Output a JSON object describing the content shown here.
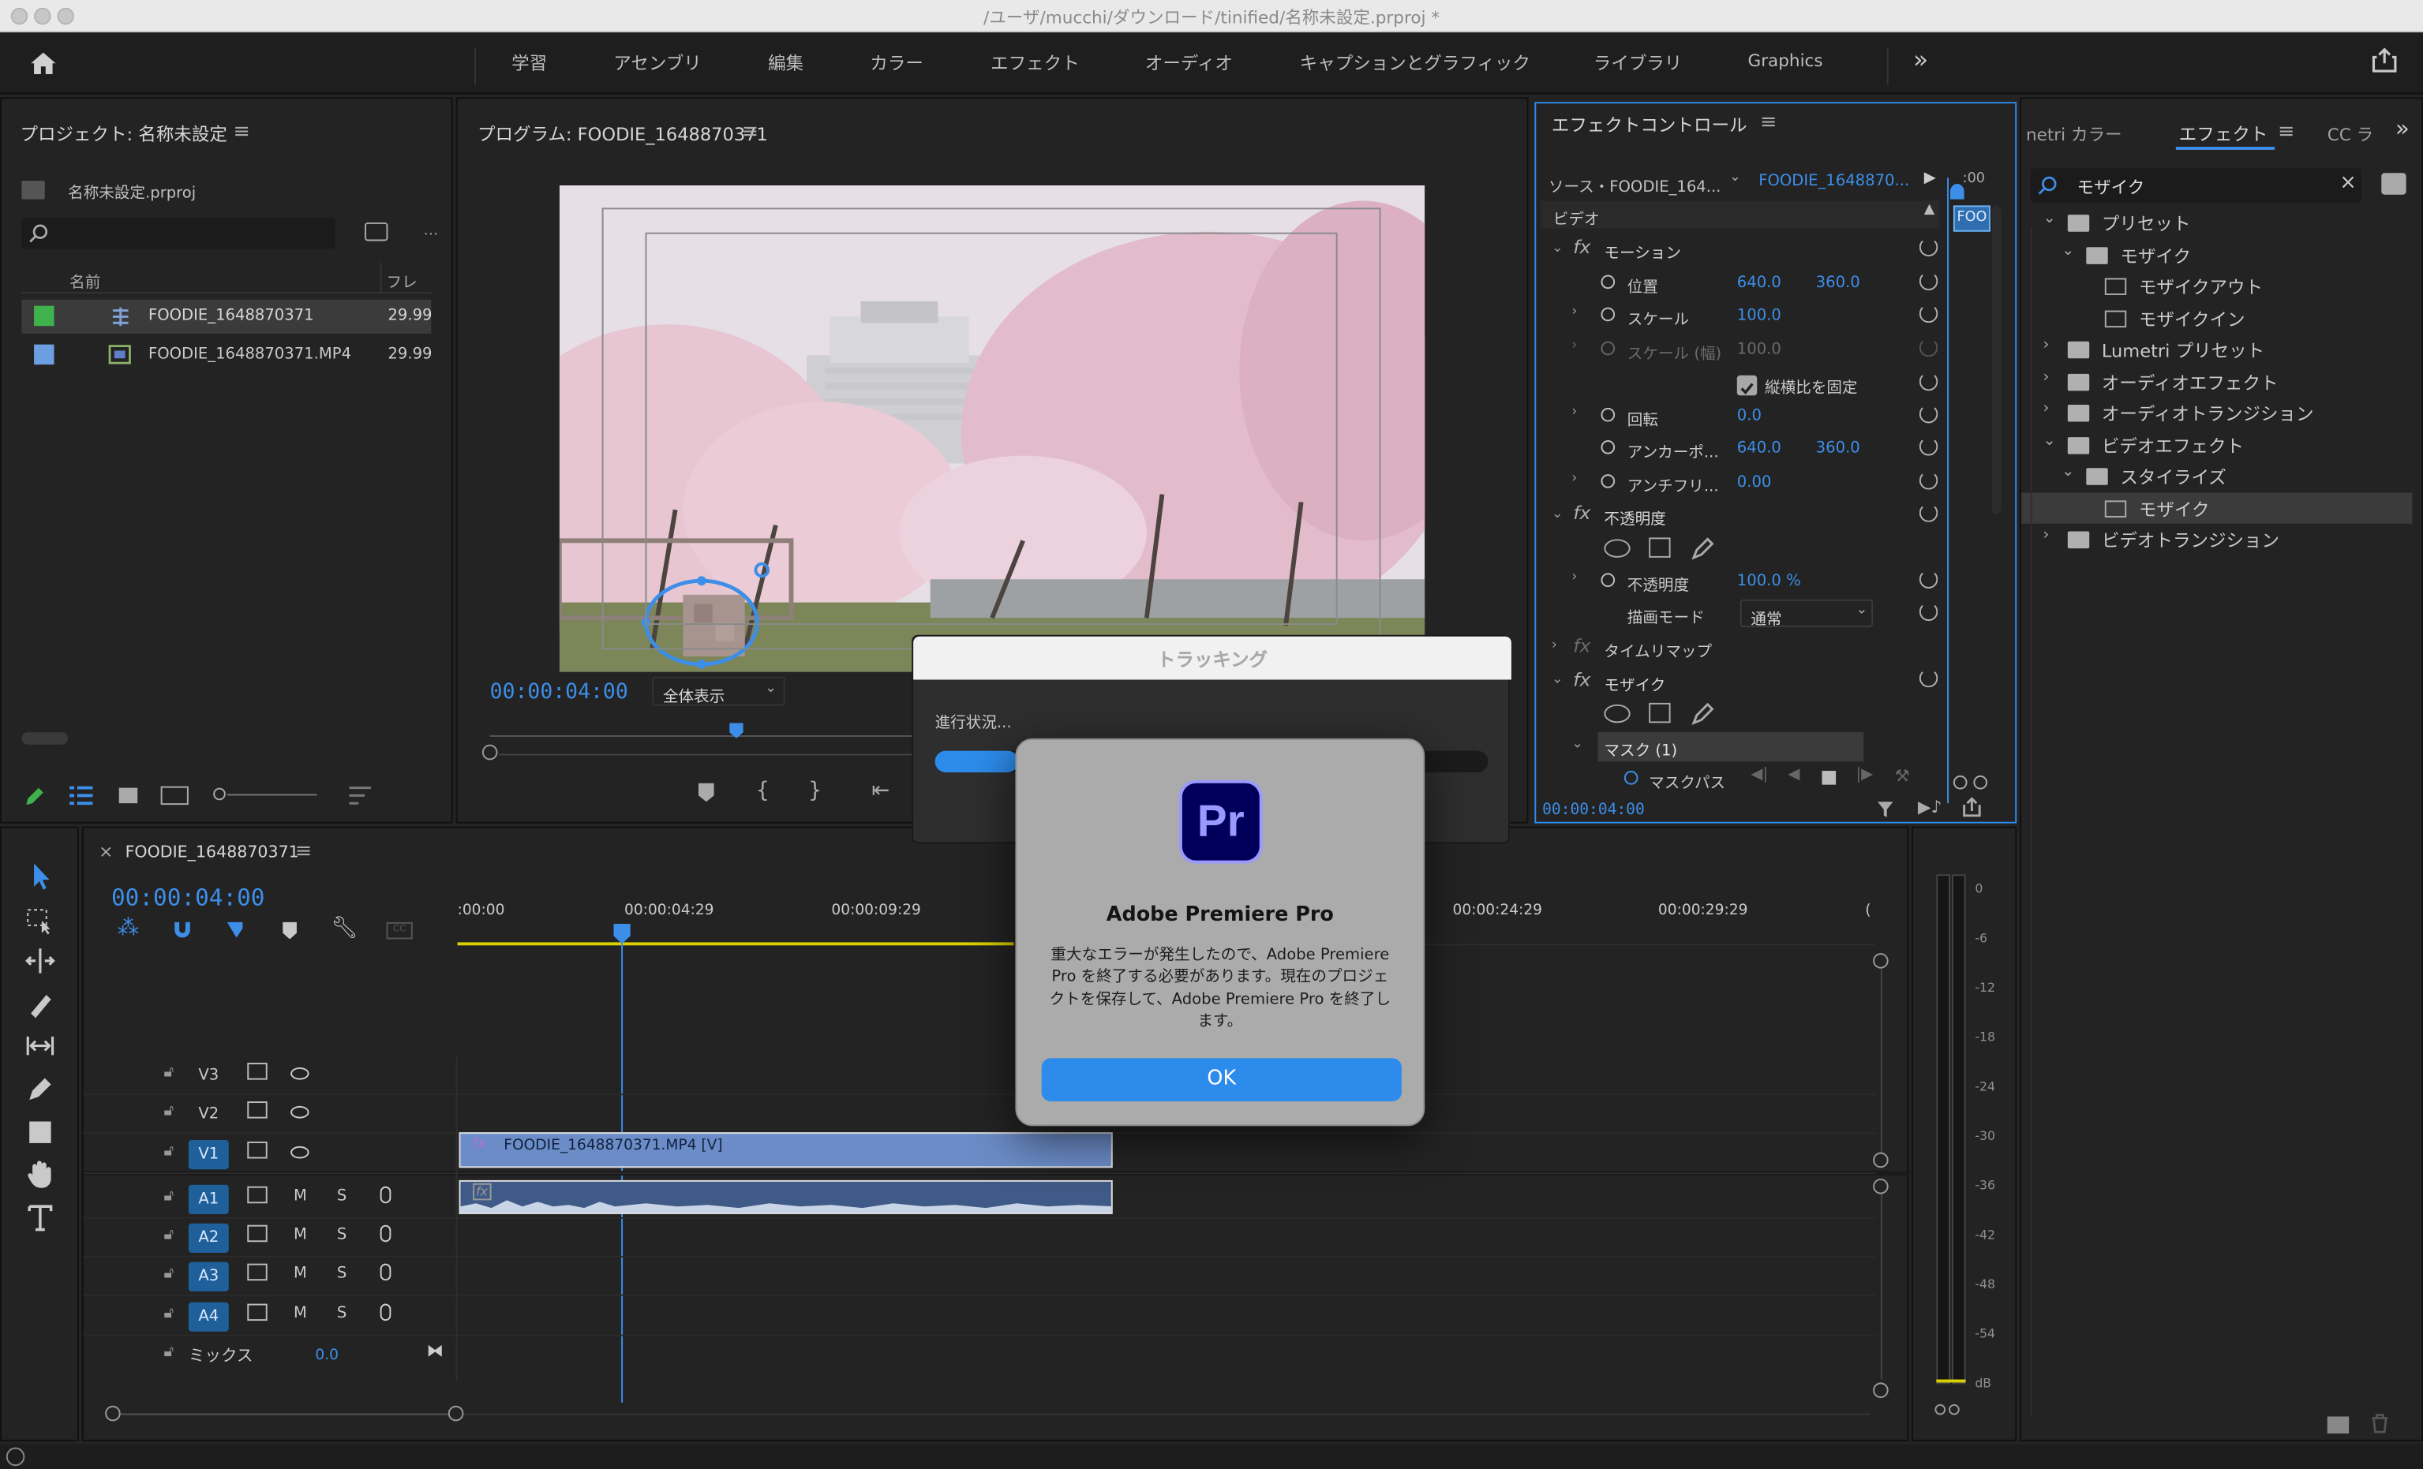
{
  "window": {
    "title": "/ユーザ/mucchi/ダウンロード/tinified/名称未設定.prproj *"
  },
  "workspace_tabs": [
    "学習",
    "アセンブリ",
    "編集",
    "カラー",
    "エフェクト",
    "オーディオ",
    "キャプションとグラフィック",
    "ライブラリ",
    "Graphics"
  ],
  "project": {
    "title": "プロジェクト: 名称未設定",
    "file": "名称未設定.prproj",
    "col_name": "名前",
    "col_rate": "フレー",
    "items": [
      {
        "name": "FOODIE_1648870371",
        "rate": "29.99",
        "color": "#3fb24d"
      },
      {
        "name": "FOODIE_1648870371.MP4",
        "rate": "29.99",
        "color": "#6c9fe0"
      }
    ]
  },
  "program": {
    "title": "プログラム: FOODIE_1648870371",
    "timecode": "00:00:04:00",
    "zoom": "全体表示"
  },
  "effect_controls": {
    "title": "エフェクトコントロール",
    "source": "ソース・FOODIE_164...",
    "clip": "FOODIE_1648870...",
    "ruler_time": ":00",
    "clip_chip": "FOO",
    "video_label": "ビデオ",
    "motion": "モーション",
    "position_label": "位置",
    "position_x": "640.0",
    "position_y": "360.0",
    "scale_label": "スケール",
    "scale_value": "100.0",
    "scale_w_label": "スケール (幅)",
    "scale_w_value": "100.0",
    "uniform_label": "縦横比を固定",
    "rotation_label": "回転",
    "rotation_value": "0.0",
    "anchor_label": "アンカーポ...",
    "anchor_x": "640.0",
    "anchor_y": "360.0",
    "antiflicker_label": "アンチフリ...",
    "antiflicker_value": "0.00",
    "opacity_section": "不透明度",
    "opacity_label": "不透明度",
    "opacity_value": "100.0 %",
    "blend_label": "描画モード",
    "blend_value": "通常",
    "timeremap": "タイムリマップ",
    "mosaic": "モザイク",
    "mask": "マスク (1)",
    "maskpath": "マスクパス",
    "footer_time": "00:00:04:00"
  },
  "effects_panel": {
    "tab_lumetri": "netri カラー",
    "tab_effects": "エフェクト",
    "tab_cc": "CC ラ",
    "search_value": "モザイク",
    "tree": [
      {
        "label": "プリセット",
        "level": 0,
        "open": true
      },
      {
        "label": "モザイク",
        "level": 1,
        "open": true
      },
      {
        "label": "モザイクアウト",
        "level": 2
      },
      {
        "label": "モザイクイン",
        "level": 2
      },
      {
        "label": "Lumetri プリセット",
        "level": 0
      },
      {
        "label": "オーディオエフェクト",
        "level": 0
      },
      {
        "label": "オーディオトランジション",
        "level": 0
      },
      {
        "label": "ビデオエフェクト",
        "level": 0,
        "open": true
      },
      {
        "label": "スタイライズ",
        "level": 1,
        "open": true
      },
      {
        "label": "モザイク",
        "level": 2,
        "selected": true
      },
      {
        "label": "ビデオトランジション",
        "level": 0
      }
    ]
  },
  "timeline": {
    "tab": "FOODIE_1648870371",
    "timecode": "00:00:04:00",
    "ruler": [
      ":00:00",
      "00:00:04:29",
      "00:00:09:29",
      "00:00:24:29",
      "00:00:29:29",
      "("
    ],
    "video_tracks": [
      "V3",
      "V2",
      "V1"
    ],
    "audio_tracks": [
      "A1",
      "A2",
      "A3",
      "A4"
    ],
    "mute": "M",
    "solo": "S",
    "mix_label": "ミックス",
    "mix_value": "0.0",
    "clip_video": "FOODIE_1648870371.MP4 [V]"
  },
  "meter": {
    "ticks": [
      "0",
      "-6",
      "-12",
      "-18",
      "-24",
      "-30",
      "-36",
      "-42",
      "-48",
      "-54",
      "dB"
    ]
  },
  "tracking_dialog": {
    "title": "トラッキング",
    "progress_label": "進行状況...",
    "progress": 0.15
  },
  "alert": {
    "app_icon": "Pr",
    "title": "Adobe Premiere Pro",
    "message": "重大なエラーが発生したので、Adobe Premiere Pro を終了する必要があります。現在のプロジェクトを保存して、Adobe Premiere Pro を終了します。",
    "ok": "OK"
  },
  "colors": {
    "accent": "#2d8ceb",
    "timecode": "#3d8ee8",
    "playhead": "#3d8ee8"
  }
}
